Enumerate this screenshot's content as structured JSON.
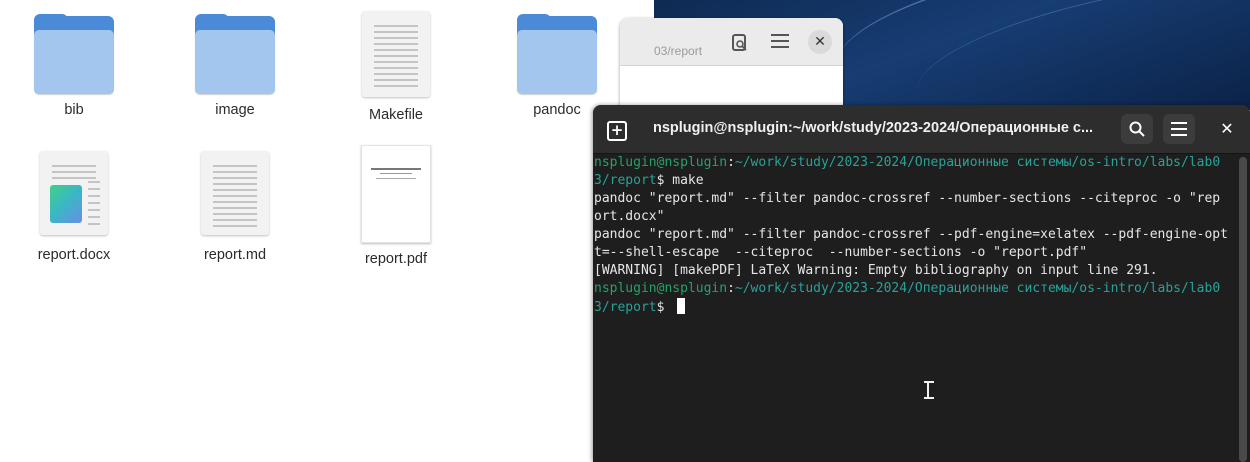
{
  "file_manager": {
    "items": [
      {
        "label": "bib",
        "type": "folder"
      },
      {
        "label": "image",
        "type": "folder"
      },
      {
        "label": "Makefile",
        "type": "text-file"
      },
      {
        "label": "pandoc",
        "type": "folder"
      },
      {
        "label": "report.docx",
        "type": "docx-file"
      },
      {
        "label": "report.md",
        "type": "text-file"
      },
      {
        "label": "report.pdf",
        "type": "pdf-file"
      }
    ]
  },
  "background_window": {
    "path": "03/report",
    "icons": [
      "preview-icon",
      "menu-icon",
      "close-icon"
    ]
  },
  "terminal": {
    "title": "nsplugin@nsplugin:~/work/study/2023-2024/Операционные с...",
    "header_icons": [
      "new-tab-icon",
      "search-icon",
      "hamburger-menu-icon",
      "close-icon"
    ],
    "lines": [
      {
        "user": "nsplugin@nsplugin",
        "sep": ":",
        "path": "~/work/study/2023-2024/Операционные системы/os-intro/labs/lab0"
      },
      {
        "path": "3/report",
        "prompt": "$ ",
        "cmd": "make"
      },
      {
        "text": "pandoc \"report.md\" --filter pandoc-crossref --number-sections --citeproc -o \"rep"
      },
      {
        "text": "ort.docx\""
      },
      {
        "text": "pandoc \"report.md\" --filter pandoc-crossref --pdf-engine=xelatex --pdf-engine-opt"
      },
      {
        "text": "t=--shell-escape  --citeproc  --number-sections -o \"report.pdf\""
      },
      {
        "text": "[WARNING] [makePDF] LaTeX Warning: Empty bibliography on input line 291."
      },
      {
        "user": "nsplugin@nsplugin",
        "sep": ":",
        "path": "~/work/study/2023-2024/Операционные системы/os-intro/labs/lab0"
      },
      {
        "path": "3/report",
        "prompt": "$ ",
        "cmd": ""
      }
    ]
  },
  "colors": {
    "folder_back": "#4a8ad6",
    "folder_front": "#a3c6ee",
    "terminal_bg": "#1e1e1e",
    "prompt_user": "#26a269",
    "prompt_path": "#2aa198"
  }
}
